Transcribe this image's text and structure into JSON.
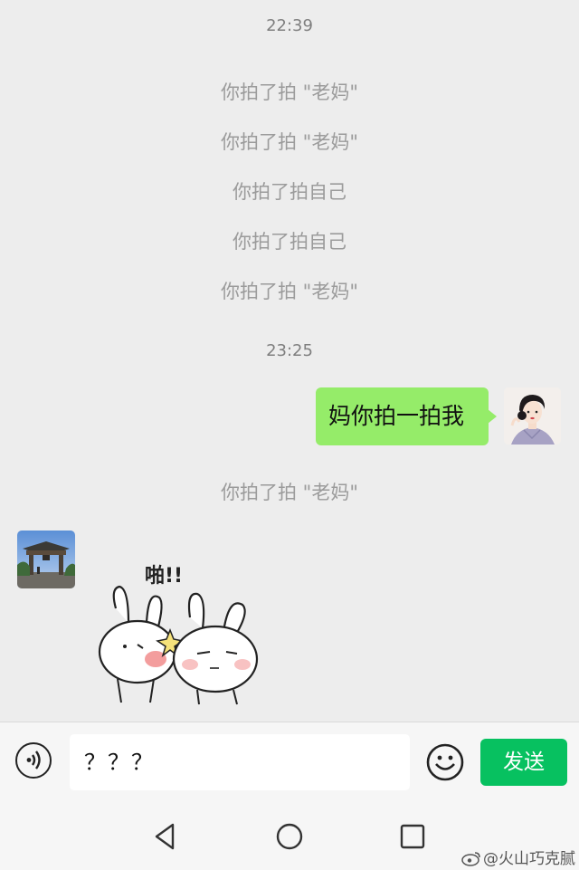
{
  "chat": {
    "time_1": "22:39",
    "events_1": [
      "你拍了拍 \"老妈\"",
      "你拍了拍 \"老妈\"",
      "你拍了拍自己",
      "你拍了拍自己",
      "你拍了拍 \"老妈\""
    ],
    "time_2": "23:25",
    "my_message": "妈你拍一拍我",
    "event_after": "你拍了拍 \"老妈\"",
    "sticker_text": "啪!!"
  },
  "input": {
    "value": "？？？",
    "send_label": "发送"
  },
  "watermark": "@火山巧克腻",
  "colors": {
    "background": "#ededed",
    "bubble": "#95ec69",
    "send_button": "#07c160",
    "system_text": "#9b9b9b"
  },
  "icons": [
    "voice-icon",
    "emoji-icon",
    "nav-back-icon",
    "nav-home-icon",
    "nav-recents-icon",
    "weibo-icon"
  ]
}
